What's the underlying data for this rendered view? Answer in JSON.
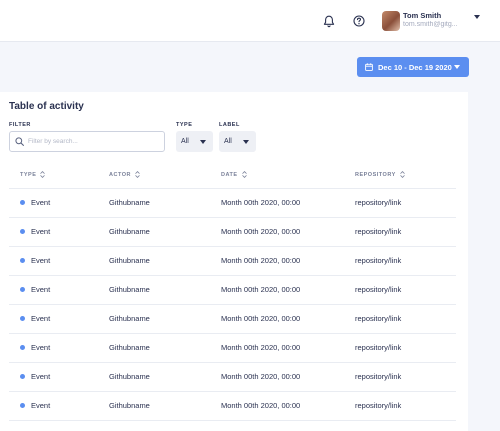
{
  "user": {
    "name": "Tom Smith",
    "email": "tom.smith@gitg..."
  },
  "date_range": {
    "label": "Dec 10 - Dec 19 2020"
  },
  "page": {
    "title": "Table of activity"
  },
  "filters": {
    "filter_label": "FILTER",
    "search_placeholder": "Filter by search...",
    "type_label": "TYPE",
    "type_value": "All",
    "label_label": "LABEL",
    "label_value": "All"
  },
  "table": {
    "columns": [
      "TYPE",
      "ACTOR",
      "DATE",
      "REPOSITORY"
    ],
    "rows": [
      {
        "type": "Event",
        "actor": "Githubname",
        "date": "Month 00th 2020, 00:00",
        "repository": "repository/link"
      },
      {
        "type": "Event",
        "actor": "Githubname",
        "date": "Month 00th 2020, 00:00",
        "repository": "repository/link"
      },
      {
        "type": "Event",
        "actor": "Githubname",
        "date": "Month 00th 2020, 00:00",
        "repository": "repository/link"
      },
      {
        "type": "Event",
        "actor": "Githubname",
        "date": "Month 00th 2020, 00:00",
        "repository": "repository/link"
      },
      {
        "type": "Event",
        "actor": "Githubname",
        "date": "Month 00th 2020, 00:00",
        "repository": "repository/link"
      },
      {
        "type": "Event",
        "actor": "Githubname",
        "date": "Month 00th 2020, 00:00",
        "repository": "repository/link"
      },
      {
        "type": "Event",
        "actor": "Githubname",
        "date": "Month 00th 2020, 00:00",
        "repository": "repository/link"
      },
      {
        "type": "Event",
        "actor": "Githubname",
        "date": "Month 00th 2020, 00:00",
        "repository": "repository/link"
      }
    ]
  },
  "icons": {
    "notifications": "bell-icon",
    "help": "help-icon",
    "calendar": "calendar-icon",
    "search": "search-icon",
    "sort": "sort-icon",
    "dropdown": "chevron-down-icon"
  },
  "colors": {
    "accent": "#5b8ef0",
    "text": "#2a3150",
    "muted": "#7a8199",
    "background": "#f4f6fb"
  }
}
